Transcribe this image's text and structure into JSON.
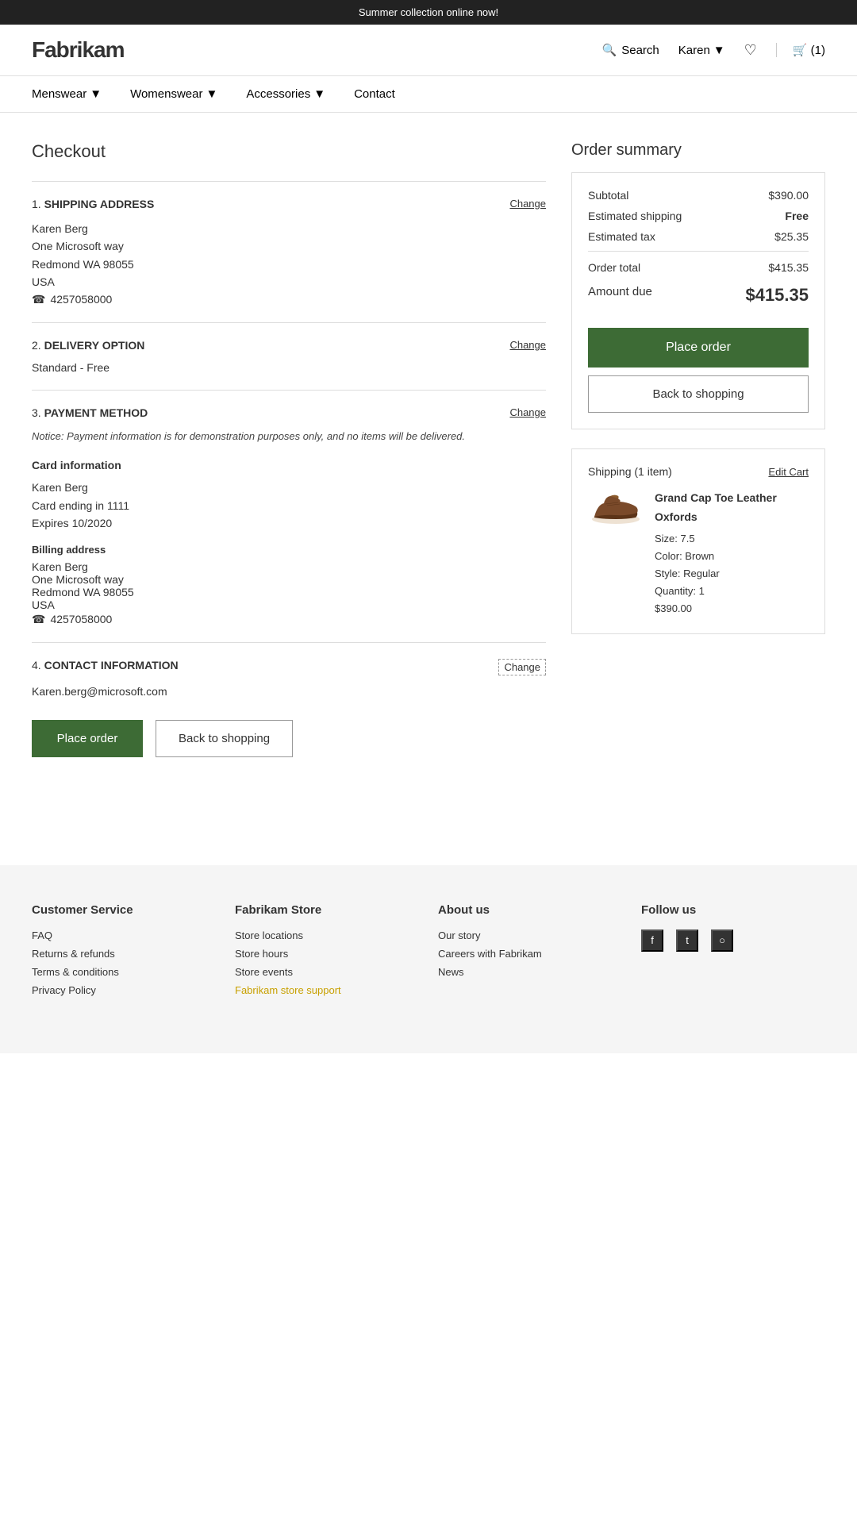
{
  "banner": {
    "text": "Summer collection online now!"
  },
  "header": {
    "logo": "Fabrikam",
    "search_label": "Search",
    "user_label": "Karen",
    "cart_label": "(1)"
  },
  "nav": {
    "items": [
      {
        "label": "Menswear",
        "has_dropdown": true
      },
      {
        "label": "Womenswear",
        "has_dropdown": true
      },
      {
        "label": "Accessories",
        "has_dropdown": true
      },
      {
        "label": "Contact",
        "has_dropdown": false
      }
    ]
  },
  "checkout": {
    "title": "Checkout",
    "sections": {
      "shipping_address": {
        "number": "1.",
        "title": "SHIPPING ADDRESS",
        "change_label": "Change",
        "name": "Karen Berg",
        "address_line1": "One Microsoft way",
        "address_line2": "Redmond WA 98055",
        "country": "USA",
        "phone": "4257058000"
      },
      "delivery_option": {
        "number": "2.",
        "title": "DELIVERY OPTION",
        "change_label": "Change",
        "value": "Standard -  Free"
      },
      "payment_method": {
        "number": "3.",
        "title": "PAYMENT METHOD",
        "change_label": "Change",
        "notice": "Notice: Payment information is for demonstration purposes only, and no items will be delivered.",
        "card_info_label": "Card information",
        "card_name": "Karen Berg",
        "card_ending": "Card ending in 1111",
        "card_expires": "Expires 10/2020",
        "billing_label": "Billing address",
        "billing_name": "Karen Berg",
        "billing_line1": "One Microsoft way",
        "billing_line2": "Redmond WA 98055",
        "billing_country": "USA",
        "billing_phone": "4257058000"
      },
      "contact_information": {
        "number": "4.",
        "title": "CONTACT INFORMATION",
        "change_label": "Change",
        "email": "Karen.berg@microsoft.com"
      }
    },
    "place_order_label": "Place order",
    "back_to_shopping_label": "Back to shopping"
  },
  "order_summary": {
    "title": "Order summary",
    "subtotal_label": "Subtotal",
    "subtotal_value": "$390.00",
    "shipping_label": "Estimated shipping",
    "shipping_value": "Free",
    "tax_label": "Estimated tax",
    "tax_value": "$25.35",
    "order_total_label": "Order total",
    "order_total_value": "$415.35",
    "amount_due_label": "Amount due",
    "amount_due_value": "$415.35",
    "place_order_label": "Place order",
    "back_to_shopping_label": "Back to shopping",
    "shipping_items_label": "Shipping (1 item)",
    "edit_cart_label": "Edit Cart",
    "item": {
      "name": "Grand Cap Toe Leather Oxfords",
      "size": "Size: 7.5",
      "color": "Color: Brown",
      "style": "Style: Regular",
      "quantity": "Quantity: 1",
      "price": "$390.00"
    }
  },
  "footer": {
    "customer_service": {
      "title": "Customer Service",
      "links": [
        "FAQ",
        "Returns & refunds",
        "Terms & conditions",
        "Privacy Policy"
      ]
    },
    "fabrikam_store": {
      "title": "Fabrikam Store",
      "links": [
        "Store locations",
        "Store hours",
        "Store events",
        "Fabrikam store support"
      ]
    },
    "about_us": {
      "title": "About us",
      "links": [
        "Our story",
        "Careers with Fabrikam",
        "News"
      ]
    },
    "follow_us": {
      "title": "Follow us",
      "socials": [
        "facebook",
        "twitter",
        "instagram"
      ]
    }
  }
}
